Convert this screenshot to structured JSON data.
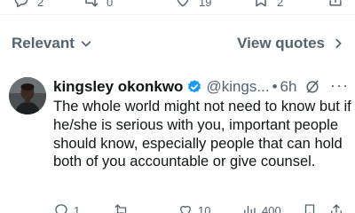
{
  "top_actions": {
    "reply_count": "2",
    "repost_count": "0",
    "like_count": "19",
    "bookmark_count": "2"
  },
  "filter": {
    "relevant_label": "Relevant",
    "view_quotes_label": "View quotes"
  },
  "reply": {
    "display_name": "kingsley okonkwo",
    "handle": "@kings...",
    "separator": "•",
    "time": "6h",
    "more_label": "···",
    "text": "The whole world might not need to know but if he/she is serious with you, important people should know, especially people that can hold both of you accountable or give counsel.",
    "actions": {
      "reply_count": "1",
      "repost_count": "",
      "like_count": "10",
      "views_count": "400"
    }
  },
  "colors": {
    "text_primary": "#0f1419",
    "text_secondary": "#536471",
    "verified_blue": "#1d9bf0",
    "divider": "#eff3f4"
  },
  "icons": {
    "reply": "reply-icon",
    "repost": "repost-icon",
    "like": "heart-icon",
    "views": "views-icon",
    "bookmark": "bookmark-icon",
    "share": "share-icon",
    "verified": "verified-badge-icon",
    "grok": "grok-icon",
    "chevron_down": "chevron-down-icon",
    "chevron_right": "chevron-right-icon"
  }
}
